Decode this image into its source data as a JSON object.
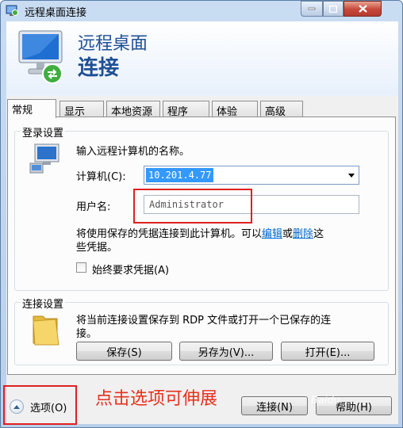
{
  "window": {
    "title": "远程桌面连接",
    "controls": {
      "minimize_icon": "minimize-icon",
      "maximize_icon": "maximize-icon",
      "close_icon": "close-icon"
    }
  },
  "header": {
    "line1": "远程桌面",
    "line2": "连接",
    "icon": "remote-desktop-monitor-icon"
  },
  "tabs": [
    {
      "label": "常规",
      "active": true
    },
    {
      "label": "显示",
      "active": false
    },
    {
      "label": "本地资源",
      "active": false
    },
    {
      "label": "程序",
      "active": false
    },
    {
      "label": "体验",
      "active": false
    },
    {
      "label": "高级",
      "active": false
    }
  ],
  "login": {
    "group_label": "登录设置",
    "prompt": "输入远程计算机的名称。",
    "computer_label": "计算机(C):",
    "computer_value": "10.201.4.77",
    "user_label": "用户名:",
    "user_value": "Administrator",
    "note_part1": "将使用保存的凭据连接到此计算机。可以",
    "note_link_edit": "编辑",
    "note_or": "或",
    "note_link_delete": "删除",
    "note_part2": "这",
    "note_line2": "些凭据。",
    "always_ask": "始终要求凭据(A)"
  },
  "connection": {
    "group_label": "连接设置",
    "desc_line1": "将当前连接设置保存到 RDP 文件或打开一个已保存的连",
    "desc_line2": "接。",
    "save_button": "保存(S)",
    "save_as_button": "另存为(V)...",
    "open_button": "打开(E)..."
  },
  "footer": {
    "options_label": "选项(O)",
    "connect_button": "连接(N)",
    "help_button": "帮助(H)"
  },
  "annotation": {
    "text": "点击选项可伸展",
    "color": "#e8301c"
  },
  "watermark": "Baidu"
}
